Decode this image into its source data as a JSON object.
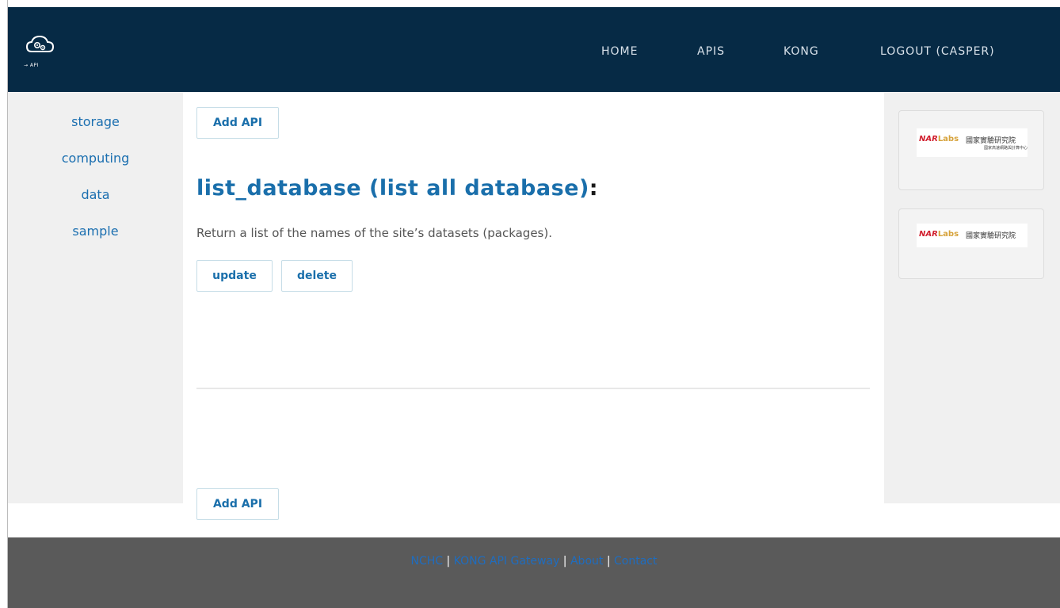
{
  "header": {
    "logo_icon": "cloud-gears-icon",
    "logo_text": "→ API",
    "nav": {
      "home": "HOME",
      "apis": "APIS",
      "kong": "KONG",
      "logout": "LOGOUT (CASPER)"
    }
  },
  "sidebar": {
    "items": [
      {
        "label": "storage"
      },
      {
        "label": "computing"
      },
      {
        "label": "data"
      },
      {
        "label": "sample"
      }
    ]
  },
  "main": {
    "add_api_top": "Add API",
    "api_name": "list_database (list all database)",
    "colon": ":",
    "description": "Return a list of the names of the site’s datasets (packages).",
    "update_label": "update",
    "delete_label": "delete",
    "add_api_bottom": "Add API"
  },
  "partners": [
    {
      "brand_nar": "NAR",
      "brand_labs": "Labs",
      "name_zh": "國家實驗研究院",
      "sub_zh": "國家高速網路與計算中心"
    },
    {
      "brand_nar": "NAR",
      "brand_labs": "Labs",
      "name_zh": "國家實驗研究院"
    }
  ],
  "footer": {
    "links": [
      "NCHC",
      "KONG API Gateway",
      "About",
      "Contact"
    ],
    "separator": " | "
  },
  "colors": {
    "navbar_bg": "#062a45",
    "link_blue": "#1a6fab",
    "footer_bg": "#5a5a5a",
    "sidebar_bg": "#f0f0f0"
  }
}
